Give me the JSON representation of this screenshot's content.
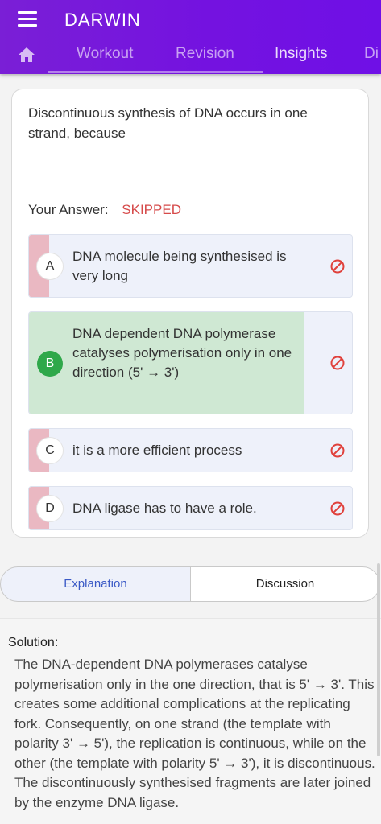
{
  "app": {
    "title": "DARWIN"
  },
  "tabs": [
    {
      "label": "Workout"
    },
    {
      "label": "Revision"
    },
    {
      "label": "Insights"
    },
    {
      "label": "Di"
    }
  ],
  "question": {
    "text": "Discontinuous synthesis of DNA occurs in one strand, because",
    "your_answer_label": "Your Answer:",
    "your_answer_value": "SKIPPED",
    "options": [
      {
        "letter": "A",
        "text": "DNA molecule being synthesised is very long",
        "correct": false
      },
      {
        "letter": "B",
        "text": "DNA dependent DNA polymerase catalyses polymerisation only in one direction (5' → 3')",
        "correct": true
      },
      {
        "letter": "C",
        "text": "it is a more efficient process",
        "correct": false
      },
      {
        "letter": "D",
        "text": "DNA ligase has to have a role.",
        "correct": false
      }
    ]
  },
  "segments": {
    "explanation": "Explanation",
    "discussion": "Discussion"
  },
  "solution": {
    "label": "Solution:",
    "text": "The DNA-dependent DNA polymerases catalyse polymerisation only in the one direction, that is 5' → 3'. This creates some additional complications at the replicating fork. Consequently, on one strand (the template with polarity 3' → 5'), the replication is continuous, while on the other (the template with polarity 5' → 3'), it is discontinuous. The discontinuously synthesised fragments are later joined by the enzyme DNA ligase."
  },
  "colors": {
    "appbar": "#7412e0",
    "skipped": "#d64a4a",
    "correct": "#2fa84a",
    "wrong_stripe": "#eab8c2",
    "ban_icon": "#e0413c"
  }
}
